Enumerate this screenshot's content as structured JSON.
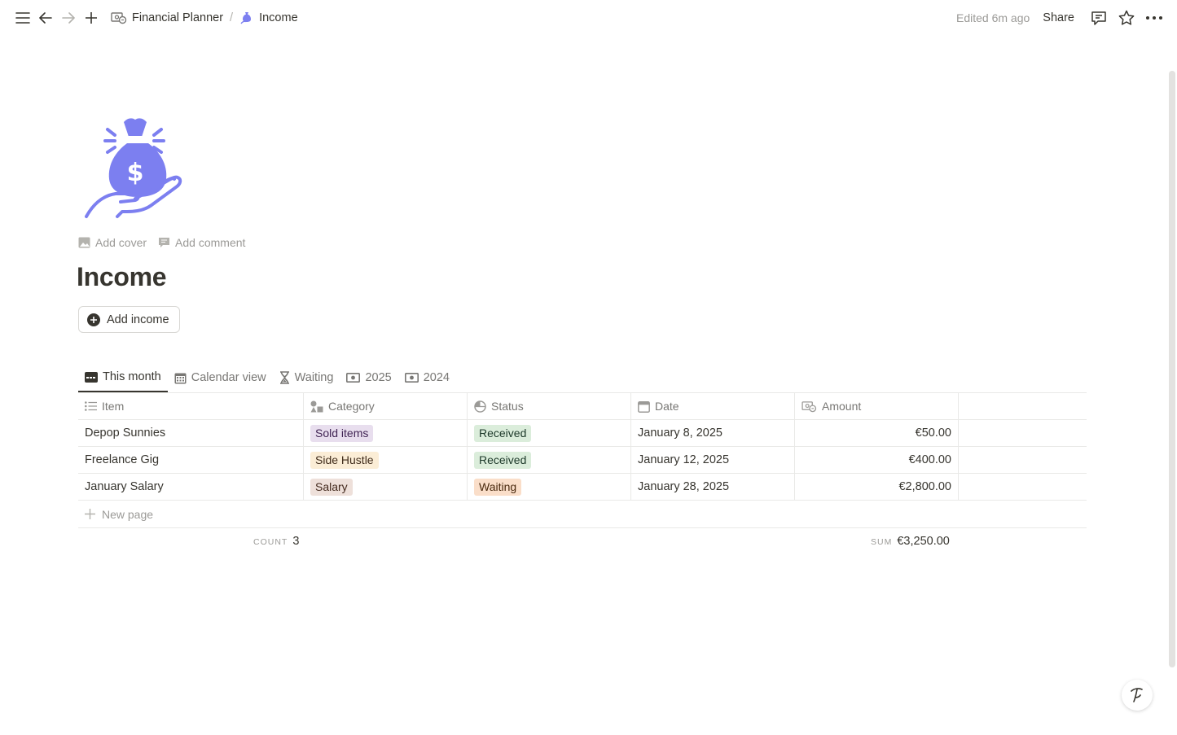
{
  "topbar": {
    "breadcrumb": [
      {
        "label": "Financial Planner",
        "icon": "money-icon"
      },
      {
        "label": "Income",
        "icon": "money-bag-icon"
      }
    ],
    "separator": "/",
    "edited": "Edited 6m ago",
    "share_label": "Share"
  },
  "page": {
    "title": "Income",
    "add_cover": "Add cover",
    "add_comment": "Add comment",
    "add_button": "Add income",
    "icon_color": "#7c7ff0"
  },
  "tabs": [
    {
      "label": "This month",
      "icon": "credit-card-icon",
      "active": true
    },
    {
      "label": "Calendar view",
      "icon": "calendar-icon",
      "active": false
    },
    {
      "label": "Waiting",
      "icon": "hourglass-icon",
      "active": false
    },
    {
      "label": "2025",
      "icon": "banknote-icon",
      "active": false
    },
    {
      "label": "2024",
      "icon": "banknote-icon",
      "active": false
    }
  ],
  "table": {
    "columns": [
      {
        "label": "Item",
        "icon": "list-icon"
      },
      {
        "label": "Category",
        "icon": "shapes-icon"
      },
      {
        "label": "Status",
        "icon": "status-icon"
      },
      {
        "label": "Date",
        "icon": "calendar-icon"
      },
      {
        "label": "Amount",
        "icon": "money-icon"
      }
    ],
    "rows": [
      {
        "item": "Depop Sunnies",
        "category": "Sold items",
        "status": "Received",
        "date": "January 8, 2025",
        "amount": "€50.00"
      },
      {
        "item": "Freelance Gig",
        "category": "Side Hustle",
        "status": "Received",
        "date": "January 12, 2025",
        "amount": "€400.00"
      },
      {
        "item": "January Salary",
        "category": "Salary",
        "status": "Waiting",
        "date": "January 28, 2025",
        "amount": "€2,800.00"
      }
    ],
    "new_page": "New page",
    "count_label": "COUNT",
    "count_value": "3",
    "sum_label": "SUM",
    "sum_value": "€3,250.00"
  },
  "colors": {
    "Sold items": {
      "bg": "#e8deee",
      "fg": "#412454"
    },
    "Side Hustle": {
      "bg": "#fbedd6",
      "fg": "#402c1b"
    },
    "Salary": {
      "bg": "#eee0da",
      "fg": "#442a1e"
    },
    "Received": {
      "bg": "#dbeddb",
      "fg": "#1c3829"
    },
    "Waiting": {
      "bg": "#fadec9",
      "fg": "#49290e"
    }
  }
}
